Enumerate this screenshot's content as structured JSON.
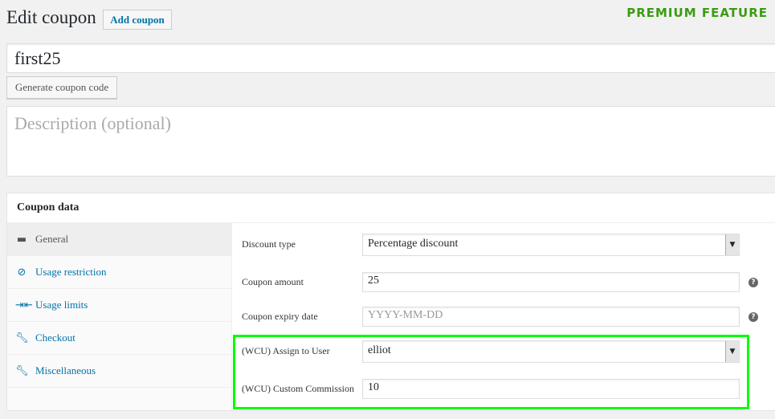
{
  "header": {
    "title": "Edit coupon",
    "add_label": "Add coupon",
    "premium": "PREMIUM FEATURE"
  },
  "coupon_code": "first25",
  "generate_label": "Generate coupon code",
  "description_placeholder": "Description (optional)",
  "panel": {
    "title": "Coupon data",
    "tabs": [
      {
        "label": "General",
        "icon": "ticket-icon"
      },
      {
        "label": "Usage restriction",
        "icon": "block-icon"
      },
      {
        "label": "Usage limits",
        "icon": "limits-icon"
      },
      {
        "label": "Checkout",
        "icon": "wrench-icon"
      },
      {
        "label": "Miscellaneous",
        "icon": "wrench-icon"
      }
    ],
    "fields": {
      "discount_type": {
        "label": "Discount type",
        "value": "Percentage discount"
      },
      "amount": {
        "label": "Coupon amount",
        "value": "25"
      },
      "expiry": {
        "label": "Coupon expiry date",
        "placeholder": "YYYY-MM-DD"
      },
      "assign": {
        "label": "(WCU) Assign to User",
        "value": "elliot"
      },
      "commission": {
        "label": "(WCU) Custom Commission",
        "value": "10"
      }
    }
  },
  "colors": {
    "highlight": "#00ff00",
    "premium": "#3b9b12",
    "link": "#0073aa"
  }
}
